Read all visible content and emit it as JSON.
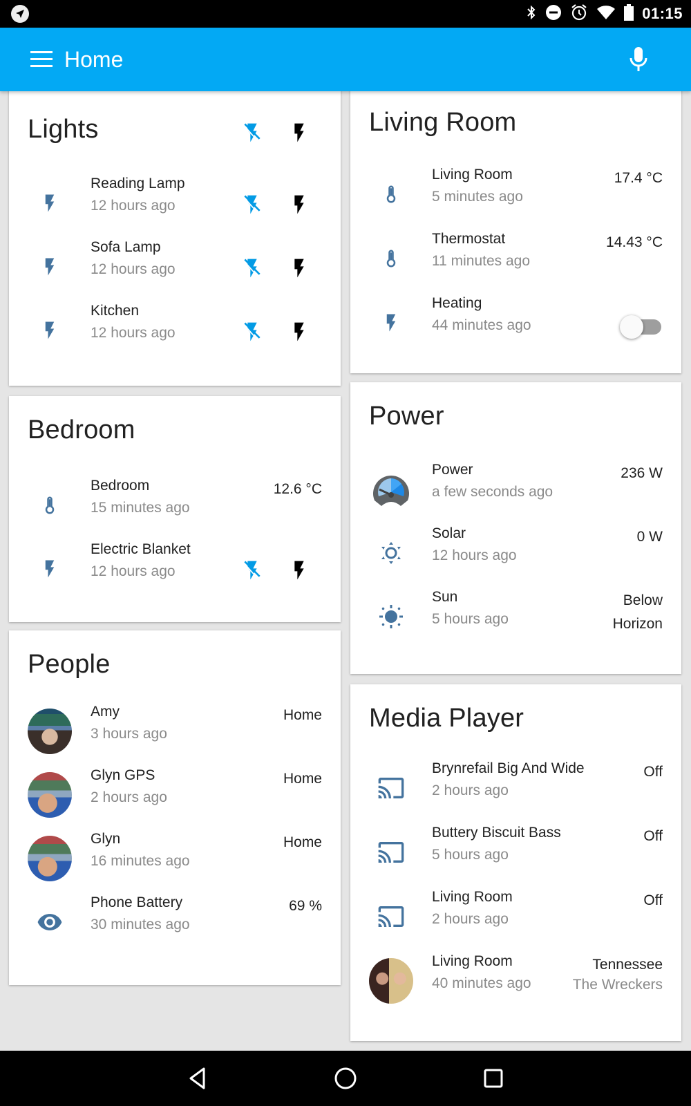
{
  "status_bar": {
    "time": "01:15",
    "icons": [
      "navigation-icon",
      "bluetooth-icon",
      "do-not-disturb-icon",
      "alarm-icon",
      "wifi-icon",
      "battery-icon"
    ]
  },
  "app_bar": {
    "title": "Home",
    "menu_icon": "hamburger-menu-icon",
    "voice_icon": "microphone-icon"
  },
  "colors": {
    "app_bar": "#03a9f4",
    "icon_blue": "#44739e",
    "off_button": "#039be5",
    "on_button": "#000000",
    "background": "#e5e5e5"
  },
  "cards": {
    "lights": {
      "title": "Lights",
      "group_actions": {
        "off_icon": "flash-off-icon",
        "on_icon": "flash-icon"
      },
      "items": [
        {
          "name": "Reading Lamp",
          "time": "12 hours ago",
          "icon": "flash-icon"
        },
        {
          "name": "Sofa Lamp",
          "time": "12 hours ago",
          "icon": "flash-icon"
        },
        {
          "name": "Kitchen",
          "time": "12 hours ago",
          "icon": "flash-icon"
        }
      ]
    },
    "bedroom": {
      "title": "Bedroom",
      "items": [
        {
          "name": "Bedroom",
          "time": "15 minutes ago",
          "value": "12.6 °C",
          "icon": "thermometer-icon"
        },
        {
          "name": "Electric Blanket",
          "time": "12 hours ago",
          "icon": "flash-icon"
        }
      ]
    },
    "people": {
      "title": "People",
      "items": [
        {
          "name": "Amy",
          "time": "3 hours ago",
          "value": "Home",
          "icon": "avatar"
        },
        {
          "name": "Glyn GPS",
          "time": "2 hours ago",
          "value": "Home",
          "icon": "avatar"
        },
        {
          "name": "Glyn",
          "time": "16 minutes ago",
          "value": "Home",
          "icon": "avatar"
        },
        {
          "name": "Phone Battery",
          "time": "30 minutes ago",
          "value": "69 %",
          "icon": "eye-icon"
        }
      ]
    },
    "living_room": {
      "title": "Living Room",
      "items": [
        {
          "name": "Living Room",
          "time": "5 minutes ago",
          "value": "17.4 °C",
          "icon": "thermometer-icon"
        },
        {
          "name": "Thermostat",
          "time": "11 minutes ago",
          "value": "14.43 °C",
          "icon": "thermometer-icon"
        },
        {
          "name": "Heating",
          "time": "44 minutes ago",
          "toggle_on": false,
          "icon": "flash-icon"
        }
      ]
    },
    "power": {
      "title": "Power",
      "items": [
        {
          "name": "Power",
          "time": "a few seconds ago",
          "value": "236 W",
          "icon": "gauge-icon"
        },
        {
          "name": "Solar",
          "time": "12 hours ago",
          "value": "0 W",
          "icon": "brightness-icon"
        },
        {
          "name": "Sun",
          "time": "5 hours ago",
          "value_line1": "Below",
          "value_line2": "Horizon",
          "icon": "sun-icon"
        }
      ]
    },
    "media_player": {
      "title": "Media Player",
      "items": [
        {
          "name": "Brynrefail Big And Wide",
          "time": "2 hours ago",
          "value": "Off",
          "icon": "cast-icon"
        },
        {
          "name": "Buttery Biscuit Bass",
          "time": "5 hours ago",
          "value": "Off",
          "icon": "cast-icon"
        },
        {
          "name": "Living Room",
          "time": "2 hours ago",
          "value": "Off",
          "icon": "cast-icon"
        },
        {
          "name": "Living Room",
          "time": "40 minutes ago",
          "value": "Tennessee",
          "value_secondary": "The Wreckers",
          "icon": "album-art"
        }
      ]
    }
  },
  "nav_bar": {
    "buttons": [
      "back-icon",
      "home-icon",
      "recents-icon"
    ]
  }
}
